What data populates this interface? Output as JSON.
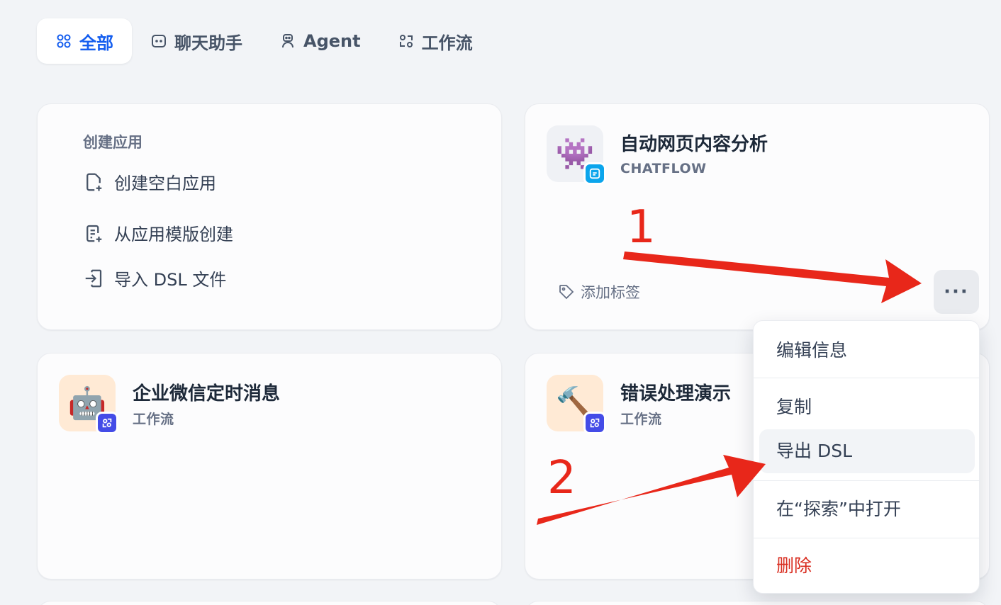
{
  "tabs": [
    {
      "label": "全部",
      "icon": "grid-icon",
      "active": true
    },
    {
      "label": "聊天助手",
      "icon": "chat-icon"
    },
    {
      "label": "Agent",
      "icon": "robot-icon"
    },
    {
      "label": "工作流",
      "icon": "workflow-icon"
    }
  ],
  "create": {
    "title": "创建应用",
    "blank": "创建空白应用",
    "template": "从应用模版创建",
    "import": "导入 DSL 文件"
  },
  "apps": [
    {
      "name": "自动网页内容分析",
      "type": "CHATFLOW",
      "icon": "👾",
      "icon_bg": "#eff1f5",
      "badge_color": "#0ba5ec",
      "tag": "添加标签"
    },
    {
      "name": "企业微信定时消息",
      "type": "工作流",
      "icon": "🤖",
      "icon_bg": "#ffead5",
      "badge_color": "#444ce7"
    },
    {
      "name": "错误处理演示",
      "type": "工作流",
      "icon": "🔨",
      "icon_bg": "#ffead5",
      "badge_color": "#444ce7"
    }
  ],
  "more": {
    "label": "···"
  },
  "menu": {
    "edit": "编辑信息",
    "copy": "复制",
    "export": "导出 DSL",
    "explore": "在“探索”中打开",
    "delete": "删除"
  },
  "annotations": {
    "step1": "1",
    "step2": "2"
  },
  "colors": {
    "accent": "#155eef",
    "arrow": "#e8271a",
    "danger": "#d92d20"
  }
}
